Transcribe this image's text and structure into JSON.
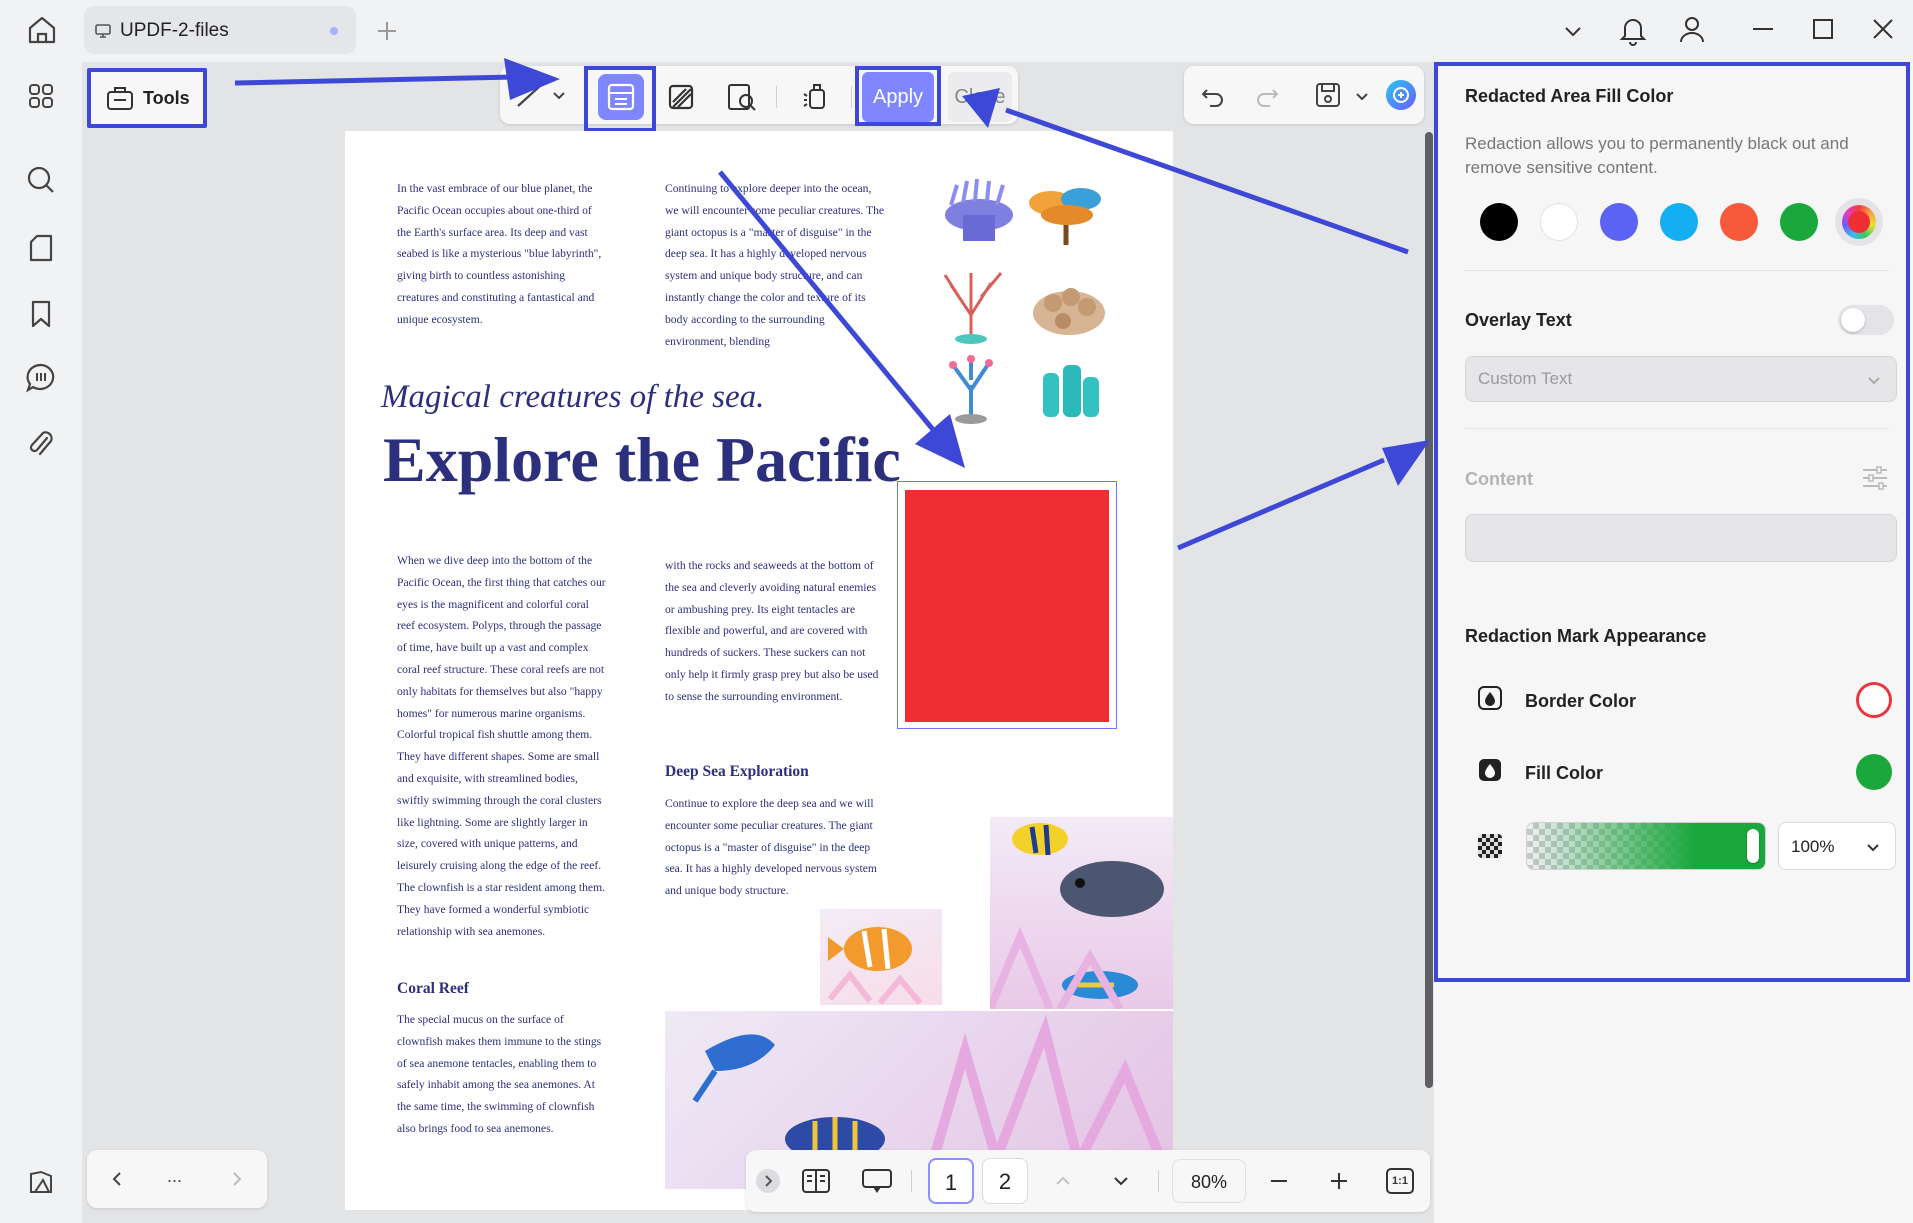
{
  "app": {
    "tab_title": "UPDF-2-files"
  },
  "toolbar": {
    "tools_label": "Tools",
    "apply_label": "Apply",
    "close_label": "Close"
  },
  "document": {
    "col1_top": "In the vast embrace of our blue planet, the Pacific Ocean occupies about one-third of the Earth's surface area. Its deep and vast seabed is like a mysterious \"blue labyrinth\", giving birth to countless astonishing creatures and constituting a fantastical and unique ecosystem.",
    "col2_top": "Continuing to explore deeper into the ocean, we will encounter some peculiar creatures. The giant octopus is a \"master of disguise\" in the deep sea. It has a highly developed nervous system and unique body structure, and can instantly change the color and texture of its body according to the surrounding environment, blending",
    "subtitle": "Magical creatures of the sea.",
    "title": "Explore the Pacific",
    "col1_body": "When we dive deep into the bottom of the Pacific Ocean, the first thing that catches our eyes is the magnificent and colorful coral reef ecosystem. Polyps, through the passage of time, have built up a vast and complex coral reef structure. These coral reefs are not only habitats for themselves but also \"happy homes\" for numerous marine organisms. Colorful tropical fish shuttle among them. They have different shapes. Some are small and exquisite, with streamlined bodies, swiftly swimming through the coral clusters like lightning. Some are slightly larger in size, covered with unique patterns, and leisurely cruising along the edge of the reef. The clownfish is a star resident among them. They have formed a wonderful symbiotic relationship with sea anemones.",
    "col2_body": "with the rocks and seaweeds at the bottom of the sea and cleverly avoiding natural enemies or ambushing prey. Its eight tentacles are flexible and powerful, and are covered with hundreds of suckers. These suckers can not only help it firmly grasp prey but also be used to sense the surrounding environment.",
    "heading_deep": "Deep Sea Exploration",
    "deep_body": "Continue to explore the deep sea and we will encounter some peculiar creatures. The giant octopus is a \"master of disguise\" in the deep sea. It has a highly developed nervous system and unique body structure.",
    "heading_coral": "Coral Reef",
    "coral_body": " The special mucus on the surface of clownfish makes them immune to the stings of sea anemone tentacles, enabling them to safely inhabit among the sea anemones. At the same time, the swimming of clownfish also brings food to sea anemones."
  },
  "panel": {
    "fill_title": "Redacted Area Fill Color",
    "fill_desc": "Redaction allows you to permanently black out and remove sensitive content.",
    "swatches": [
      "#000000",
      "#ffffff",
      "#5a63f2",
      "#14aef2",
      "#f75a3a",
      "#1aa83d",
      "multicolor"
    ],
    "overlay_title": "Overlay Text",
    "custom_text_placeholder": "Custom Text",
    "content_title": "Content",
    "appearance_title": "Redaction Mark Appearance",
    "border_color_label": "Border Color",
    "fill_color_label": "Fill Color",
    "opacity_value": "100%",
    "border_color": "#e8383f",
    "fill_color": "#1aa83d"
  },
  "bottom": {
    "ellipsis": "...",
    "page1": "1",
    "page2": "2",
    "zoom": "80%",
    "fit_label": "1:1"
  },
  "colors": {
    "accent": "#7f86ff",
    "annotation_blue": "#3d48d6",
    "redaction_red": "#ee2e33"
  }
}
